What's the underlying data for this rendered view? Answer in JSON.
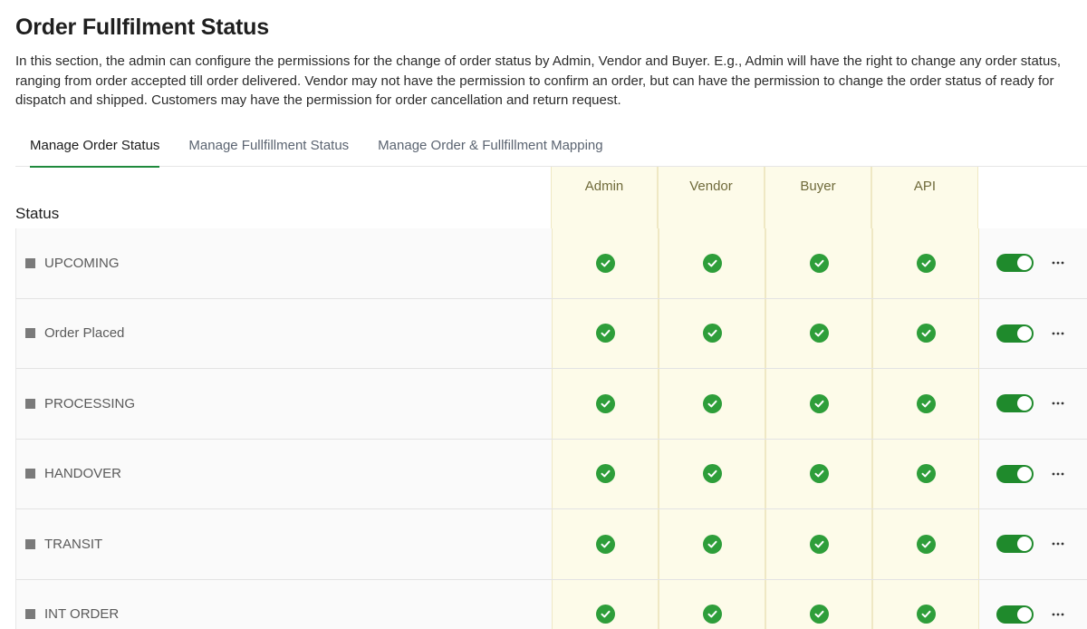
{
  "page": {
    "title": "Order Fullfilment Status",
    "description": "In this section, the admin can configure the permissions for the change of order status by Admin, Vendor and Buyer. E.g., Admin will have the right to change any order status, ranging from order accepted till order delivered. Vendor may not have the permission to confirm an order, but can have the permission to change the order status of ready for dispatch and shipped. Customers may have the permission for order cancellation and return request."
  },
  "tabs": [
    {
      "label": "Manage Order Status",
      "active": true
    },
    {
      "label": "Manage Fullfillment Status",
      "active": false
    },
    {
      "label": "Manage Order & Fullfillment Mapping",
      "active": false
    }
  ],
  "table": {
    "status_header": "Status",
    "columns": [
      "Admin",
      "Vendor",
      "Buyer",
      "API"
    ],
    "rows": [
      {
        "label": "UPCOMING",
        "admin": true,
        "vendor": true,
        "buyer": true,
        "api": true,
        "enabled": true
      },
      {
        "label": "Order Placed",
        "admin": true,
        "vendor": true,
        "buyer": true,
        "api": true,
        "enabled": true
      },
      {
        "label": "PROCESSING",
        "admin": true,
        "vendor": true,
        "buyer": true,
        "api": true,
        "enabled": true
      },
      {
        "label": "HANDOVER",
        "admin": true,
        "vendor": true,
        "buyer": true,
        "api": true,
        "enabled": true
      },
      {
        "label": "TRANSIT",
        "admin": true,
        "vendor": true,
        "buyer": true,
        "api": true,
        "enabled": true
      },
      {
        "label": "INT ORDER",
        "admin": true,
        "vendor": true,
        "buyer": true,
        "api": true,
        "enabled": true
      }
    ]
  },
  "colors": {
    "accent": "#1f8a3c",
    "check": "#2e9e3a",
    "toggle_on": "#1f8a2c",
    "column_bg": "#fdfbe9"
  },
  "icons": {
    "check": "check-circle-icon",
    "more": "more-horizontal-icon",
    "row_marker": "square-icon"
  }
}
